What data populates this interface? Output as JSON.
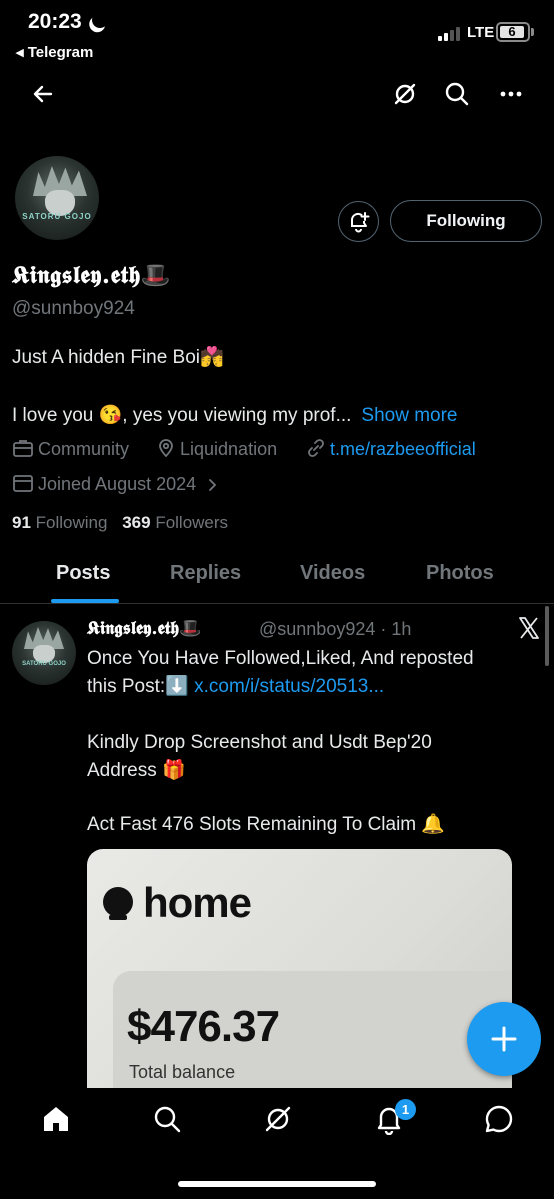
{
  "status_bar": {
    "time": "20:23",
    "back_app": "◂ Telegram",
    "network": "LTE",
    "battery": "6"
  },
  "profile": {
    "name": "𝕶𝖎𝖓𝖌𝖘𝖑𝖊𝖞.𝖊𝖙𝖍🎩",
    "handle": "@sunnboy924",
    "avatar_text": "SATORU GOJO",
    "follow_button": "Following",
    "bio_line1": "Just A hidden Fine Boi💏",
    "bio_line2": "I love you 😘, yes you viewing my prof...",
    "show_more": "Show more",
    "category": "Community",
    "location": "Liquidnation",
    "link": "t.me/razbeeofficial",
    "joined": "Joined August 2024",
    "following_count": "91",
    "following_label": "Following",
    "followers_count": "369",
    "followers_label": "Followers"
  },
  "tabs": [
    "Posts",
    "Replies",
    "Videos",
    "Photos"
  ],
  "active_tab": "Posts",
  "tweet": {
    "name": "𝕶𝖎𝖓𝖌𝖘𝖑𝖊𝖞.𝖊𝖙𝖍🎩",
    "handle_time": "@sunnboy924 · 1h",
    "line1": "Once You Have Followed,Liked, And reposted",
    "line2_prefix": "this Post:⬇️ ",
    "line2_link": "x.com/i/status/20513...",
    "line3": "Kindly Drop Screenshot and Usdt Bep'20",
    "line4": "Address 🎁",
    "line5": "Act Fast 476 Slots Remaining To Claim 🔔",
    "media_brand": "home",
    "media_amount": "$476.37",
    "media_caption": "Total balance"
  },
  "notifications_badge": "1",
  "icons": {
    "back": "arrow-left-icon",
    "grok": "grok-icon",
    "search": "search-icon",
    "more": "more-icon",
    "bell_plus": "bell-plus-icon",
    "x_logo": "x-logo-icon",
    "compose": "plus-icon",
    "home": "home-icon",
    "explore": "search-icon",
    "notifications": "bell-icon",
    "messages": "message-icon"
  },
  "colors": {
    "accent": "#1d9bf0",
    "background": "#000000",
    "muted": "#71767b"
  }
}
